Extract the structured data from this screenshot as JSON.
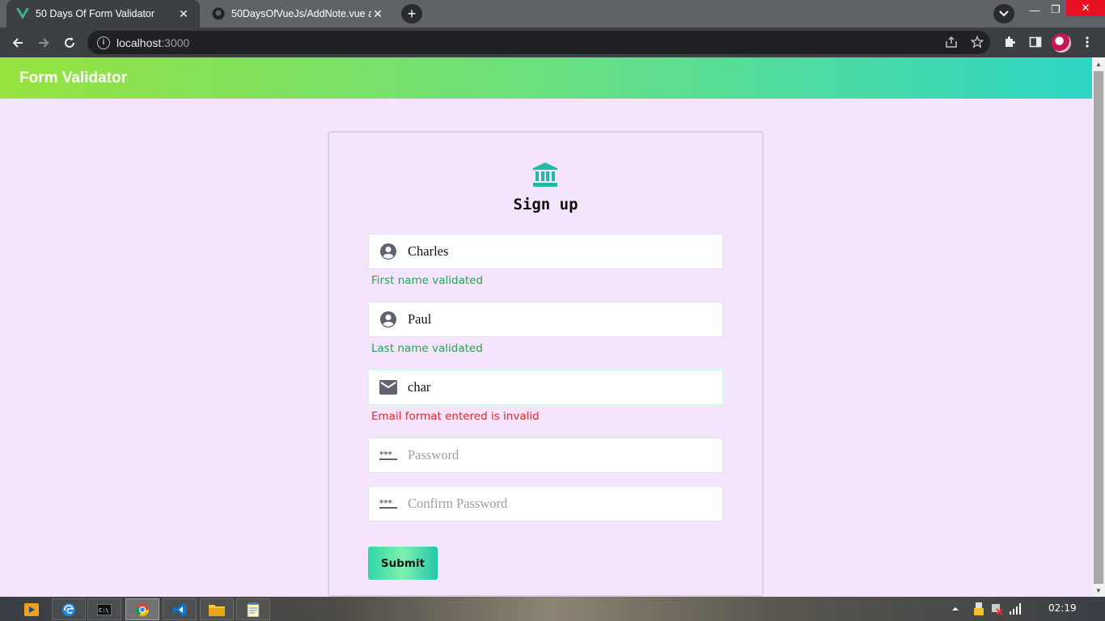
{
  "browser": {
    "tabs": [
      {
        "title": "50 Days Of Form Validator",
        "favicon": "vue-icon",
        "active": true
      },
      {
        "title": "50DaysOfVueJs/AddNote.vue at",
        "favicon": "github-icon",
        "active": false
      }
    ],
    "url_host": "localhost",
    "url_port": ":3000"
  },
  "app": {
    "brand": "Form Validator",
    "accent_gradient": [
      "#96e33f",
      "#2fd6c5"
    ]
  },
  "form": {
    "heading": "Sign up",
    "fields": [
      {
        "icon": "user-circle-icon",
        "value": "Charles",
        "placeholder": "",
        "message": "First name validated",
        "status": "valid"
      },
      {
        "icon": "user-circle-icon",
        "value": "Paul",
        "placeholder": "",
        "message": "Last name validated",
        "status": "valid"
      },
      {
        "icon": "mail-icon",
        "value": "char",
        "placeholder": "",
        "message": "Email format entered is invalid",
        "status": "invalid"
      },
      {
        "icon": "password-icon",
        "value": "",
        "placeholder": "Password",
        "message": "",
        "status": "empty"
      },
      {
        "icon": "password-icon",
        "value": "",
        "placeholder": "Confirm Password",
        "message": "",
        "status": "empty"
      }
    ],
    "submit_label": "Submit",
    "colors": {
      "valid": "#2e9d55",
      "invalid": "#d32f2f",
      "logo": "#26b8a6"
    }
  },
  "taskbar": {
    "clock": "02:19"
  }
}
